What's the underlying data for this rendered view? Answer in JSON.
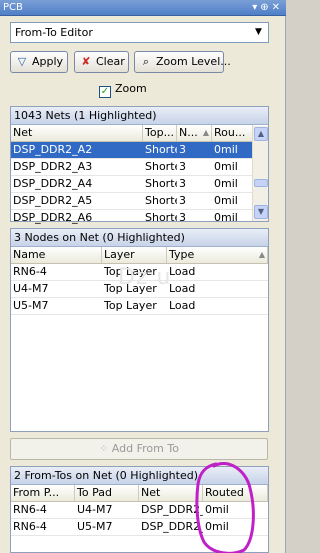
{
  "window": {
    "title": "PCB",
    "icons": [
      "dropdown-arrow-icon",
      "pin-icon",
      "close-icon"
    ]
  },
  "editor_combo": {
    "value": "From-To Editor"
  },
  "toolbar": {
    "apply_label": "Apply",
    "clear_label": "Clear",
    "zoom_level_label": "Zoom Level...",
    "zoom_label": "Zoom",
    "zoom_checked": true
  },
  "nets": {
    "header": "1043 Nets (1 Highlighted)",
    "columns": [
      "Net",
      "Top...",
      "N...",
      "Rou..."
    ],
    "rows": [
      [
        "DSP_DDR2_A2",
        "Shorte",
        "3",
        "0mil"
      ],
      [
        "DSP_DDR2_A3",
        "Shorte",
        "3",
        "0mil"
      ],
      [
        "DSP_DDR2_A4",
        "Shorte",
        "3",
        "0mil"
      ],
      [
        "DSP_DDR2_A5",
        "Shorte",
        "3",
        "0mil"
      ],
      [
        "DSP_DDR2_A6",
        "Shorte",
        "3",
        "0mil"
      ]
    ],
    "selected_index": 0
  },
  "nodes": {
    "header": "3 Nodes on Net (0 Highlighted)",
    "columns": [
      "Name",
      "Layer",
      "Type"
    ],
    "rows": [
      [
        "RN6-4",
        "Top Layer",
        "Load"
      ],
      [
        "U4-M7",
        "Top Layer",
        "Load"
      ],
      [
        "U5-M7",
        "Top Layer",
        "Load"
      ]
    ]
  },
  "add_from_to_label": "Add From To",
  "fromtos": {
    "header": "2 From-Tos on Net (0 Highlighted)",
    "columns": [
      "From P...",
      "To Pad",
      "Net",
      "Routed"
    ],
    "rows": [
      [
        "RN6-4",
        "U4-M7",
        "DSP_DDR2_",
        "0mil"
      ],
      [
        "RN6-4",
        "U5-M7",
        "DSP_DDR2_",
        "0mil"
      ]
    ]
  }
}
